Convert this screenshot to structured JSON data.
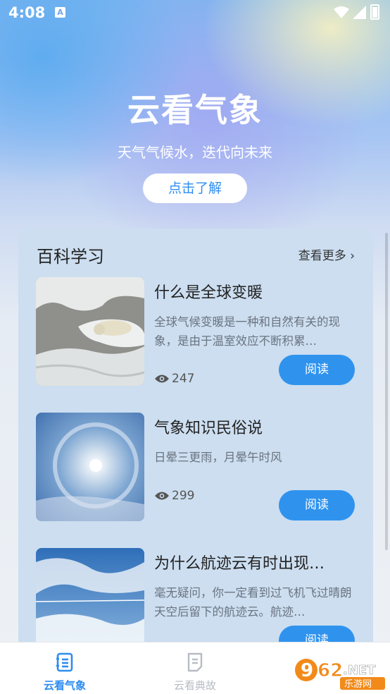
{
  "status_bar": {
    "time": "4:08",
    "notification_icon_letter": "A"
  },
  "hero": {
    "title": "云看气象",
    "subtitle": "天气气候水，迭代向未来",
    "learn_button": "点击了解"
  },
  "section": {
    "title": "百科学习",
    "more_link": "查看更多 ›",
    "articles": [
      {
        "title": "什么是全球变暖",
        "desc": "全球气候变暖是一种和自然有关的现象，是由于温室效应不断积累…",
        "views": "247",
        "read_label": "阅读",
        "image": "polar-bear-ice-image"
      },
      {
        "title": "气象知识民俗说",
        "desc": "日晕三更雨，月晕午时风",
        "views": "299",
        "read_label": "阅读",
        "image": "sun-halo-image"
      },
      {
        "title": "为什么航迹云有时出现…",
        "desc": "毫无疑问，你一定看到过飞机飞过晴朗天空后留下的航迹云。航迹…",
        "views": "",
        "read_label": "阅读",
        "image": "contrail-sky-image"
      }
    ]
  },
  "tabbar": {
    "tabs": [
      {
        "label": "云看气象",
        "active": true,
        "icon": "book-list-icon"
      },
      {
        "label": "云看典故",
        "active": false,
        "icon": "document-icon"
      }
    ]
  },
  "watermark": {
    "text": "962.NET",
    "sub": "乐游网"
  },
  "colors": {
    "accent": "#2f93ee",
    "card_bg": "#ccdef0",
    "tab_active": "#2e8df0",
    "tab_inactive": "#b7bcc4"
  }
}
